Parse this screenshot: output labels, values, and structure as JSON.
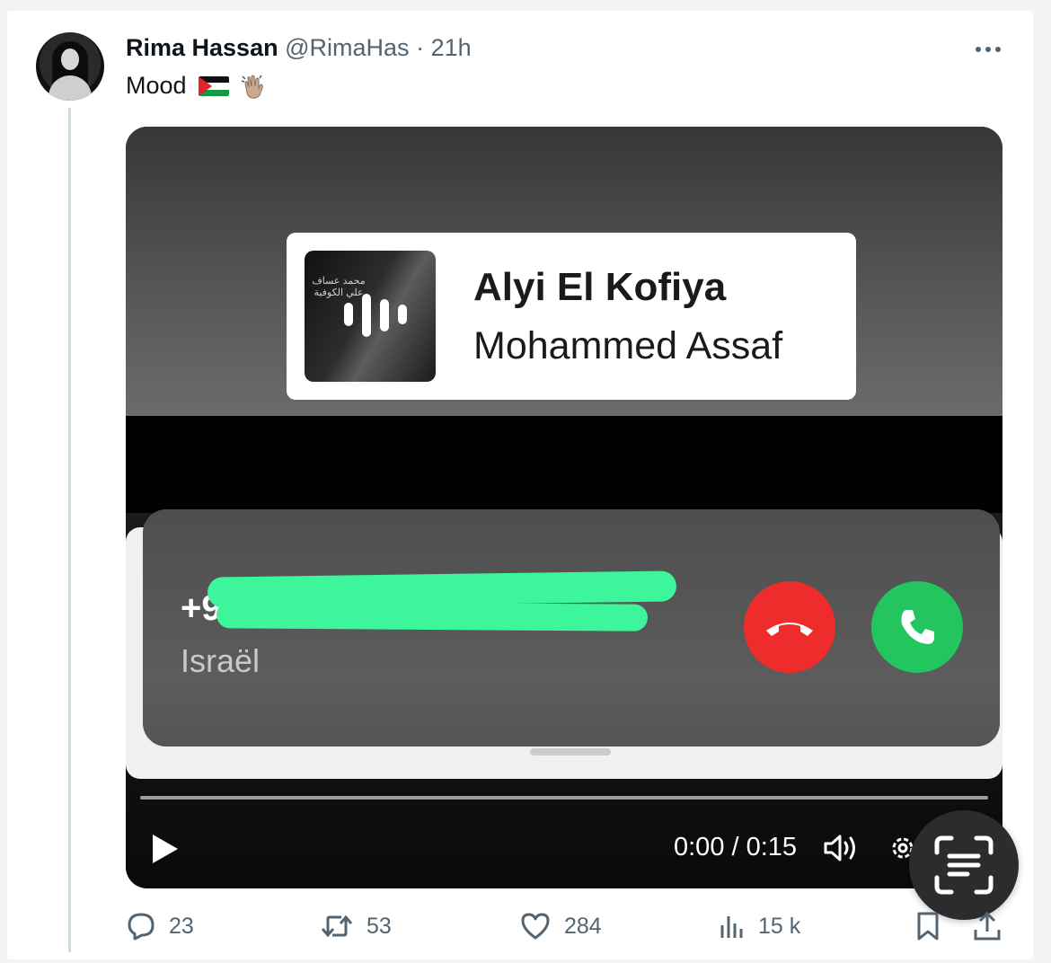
{
  "tweet": {
    "author_name": "Rima Hassan",
    "handle": "@RimaHas",
    "separator": "·",
    "time": "21h",
    "text": "Mood",
    "emojis": [
      "palestine-flag",
      "waving-hand"
    ]
  },
  "video": {
    "song_title": "Alyi El Kofiya",
    "song_artist": "Mohammed Assaf",
    "cover_arabic": "محمد عساف\nعلي الكوفية",
    "caller_number_visible": "+9",
    "caller_country": "Israël",
    "time_display": "0:00 / 0:15",
    "progress": 0.0
  },
  "actions": {
    "replies": "23",
    "reposts": "53",
    "likes": "284",
    "views": "15 k"
  },
  "colors": {
    "text_secondary": "#536471",
    "decline": "#ef2c2c",
    "accept": "#22c55e",
    "redaction": "#3df59a"
  }
}
